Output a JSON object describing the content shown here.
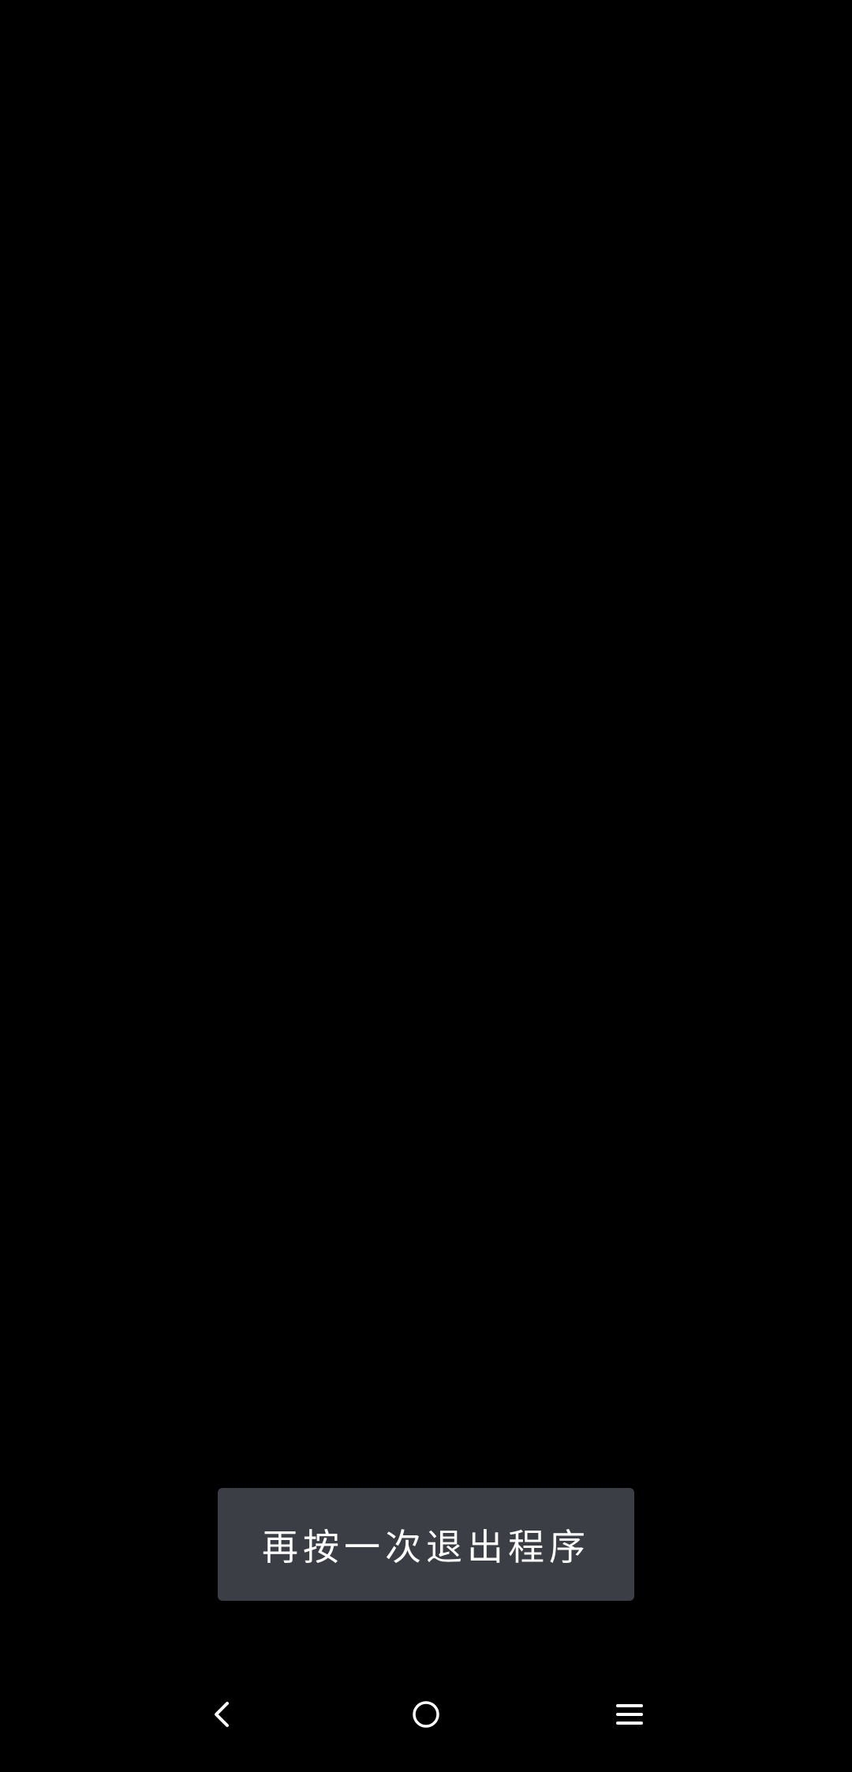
{
  "toast": {
    "message": "再按一次退出程序"
  },
  "navigation_bar": {
    "back_icon": "chevron-left-icon",
    "home_icon": "circle-home-icon",
    "recents_icon": "hamburger-menu-icon"
  },
  "colors": {
    "background": "#000000",
    "toast_background": "#3b3e45",
    "toast_text": "#ffffff",
    "nav_icon": "#ffffff"
  }
}
